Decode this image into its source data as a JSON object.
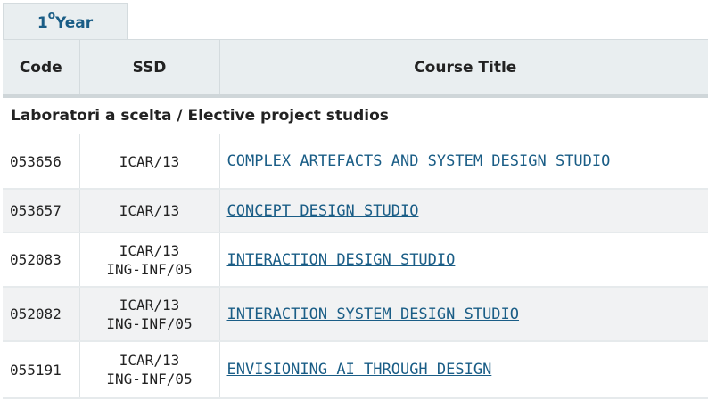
{
  "tab": {
    "label_number": "1",
    "label_sup": "o",
    "label_text": "Year"
  },
  "table": {
    "headers": {
      "code": "Code",
      "ssd": "SSD",
      "title": "Course Title"
    },
    "section_title": "Laboratori a scelta / Elective project studios",
    "rows": [
      {
        "code": "053656",
        "ssd": [
          "ICAR/13"
        ],
        "title": "COMPLEX ARTEFACTS AND SYSTEM DESIGN STUDIO"
      },
      {
        "code": "053657",
        "ssd": [
          "ICAR/13"
        ],
        "title": "CONCEPT DESIGN STUDIO"
      },
      {
        "code": "052083",
        "ssd": [
          "ICAR/13",
          "ING-INF/05"
        ],
        "title": "INTERACTION DESIGN STUDIO"
      },
      {
        "code": "052082",
        "ssd": [
          "ICAR/13",
          "ING-INF/05"
        ],
        "title": "INTERACTION SYSTEM DESIGN STUDIO"
      },
      {
        "code": "055191",
        "ssd": [
          "ICAR/13",
          "ING-INF/05"
        ],
        "title": "ENVISIONING AI THROUGH DESIGN"
      }
    ]
  },
  "colors": {
    "link": "#1a5d86",
    "header_bg": "#e9eef0",
    "alt_row_bg": "#f1f2f3"
  }
}
